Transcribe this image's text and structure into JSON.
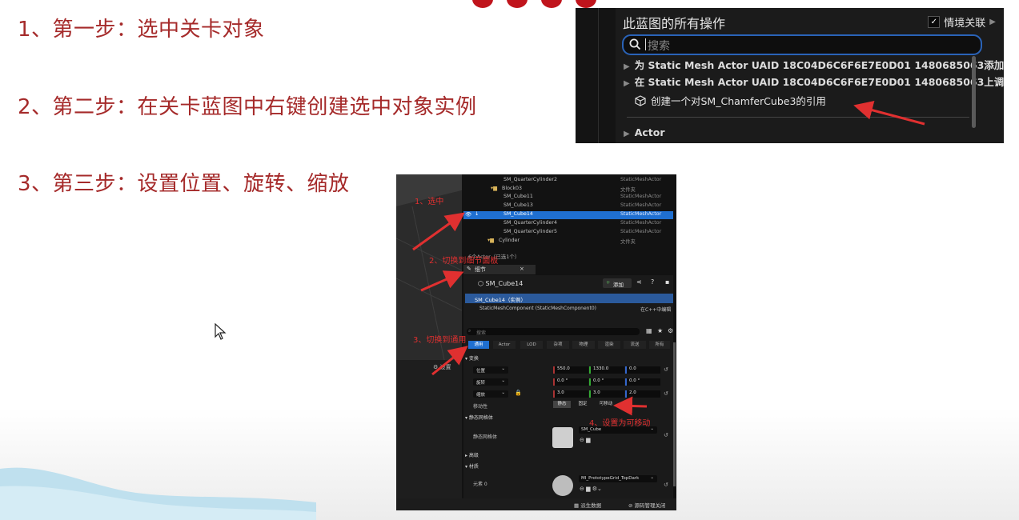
{
  "steps": [
    "1、第一步：选中关卡对象",
    "2、第二步：在关卡蓝图中右键创建选中对象实例",
    "3、第三步：设置位置、旋转、缩放"
  ],
  "blueprint_panel": {
    "title": "此蓝图的所有操作",
    "context_label": "情境关联",
    "search_placeholder": "搜索",
    "rows": [
      "为 Static Mesh Actor UAID 18C04D6C6F6E7E0D01 1480685063添加",
      "在 Static Mesh Actor UAID 18C04D6C6F6E7E0D01 1480685063上调"
    ],
    "selected_action": "创建一个对SM_ChamferCube3的引用",
    "category": "Actor"
  },
  "editor": {
    "outliner": [
      {
        "name": "SM_QuarterCylinder2",
        "type": "StaticMeshActor"
      },
      {
        "name": "Block03",
        "type": "文件夹"
      },
      {
        "name": "SM_Cube11",
        "type": "StaticMeshActor"
      },
      {
        "name": "SM_Cube13",
        "type": "StaticMeshActor"
      },
      {
        "name": "SM_Cube14",
        "type": "StaticMeshActor"
      },
      {
        "name": "SM_QuarterCylinder4",
        "type": "StaticMeshActor"
      },
      {
        "name": "SM_QuarterCylinder5",
        "type": "StaticMeshActor"
      },
      {
        "name": "Cylinder",
        "type": "文件夹"
      }
    ],
    "actor_count": "6个Actor（已选1个）",
    "details_tab": "细节",
    "object_name": "SM_Cube14",
    "add_label": "添加",
    "instance_label": "SM_Cube14（实例）",
    "component_label": "StaticMeshComponent (StaticMeshComponent0)",
    "cpp_label": "在C++中编辑",
    "search_placeholder": "搜索",
    "left_settings": "设置",
    "category_tabs": [
      "通用",
      "Actor",
      "LOD",
      "杂项",
      "物理",
      "渲染",
      "流送",
      "所有"
    ],
    "transform_header": "变换",
    "location_label": "位置",
    "rotation_label": "旋转",
    "scale_label": "缩放",
    "location": [
      "550.0",
      "1330.0",
      "0.0"
    ],
    "rotation": [
      "0.0 °",
      "0.0 °",
      "0.0 °"
    ],
    "scale": [
      "3.0",
      "3.0",
      "2.0"
    ],
    "mobility_label": "移动性",
    "mobility_options": [
      "静态",
      "固定",
      "可移动"
    ],
    "static_mesh_header": "静态网格体",
    "static_mesh_label": "静态网格体",
    "static_mesh_value": "SM_Cube",
    "advanced_label": "高级",
    "materials_header": "材质",
    "element_label": "元素 0",
    "material_value": "MI_PrototypeGrid_TopDark",
    "status_left": "派生数据",
    "status_right": "源码管理关闭"
  },
  "annotations": {
    "a1": "1、选中",
    "a2": "2、切换到细节面板",
    "a3": "3、切换到通用",
    "a4": "4、设置为可移动"
  },
  "colors": {
    "step_text": "#a52a2a",
    "arrow_red": "#e03030",
    "accent_blue": "#1f6fd0"
  }
}
